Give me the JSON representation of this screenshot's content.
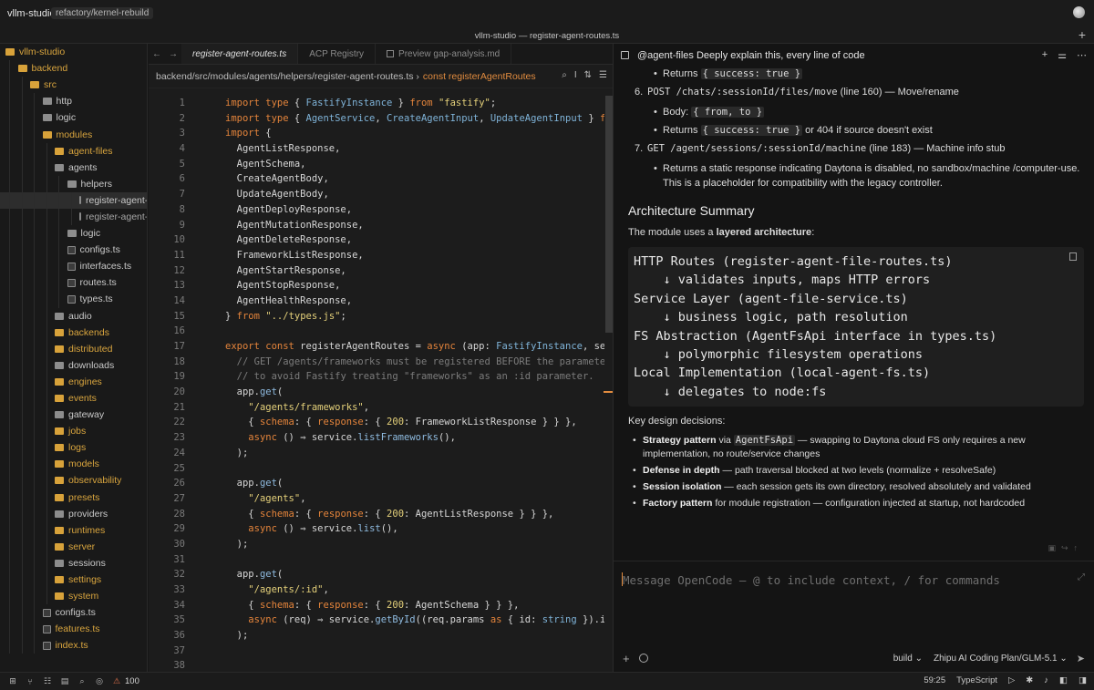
{
  "titlebar": {
    "project": "vllm-studio",
    "branch": "refactory/kernel-rebuild",
    "window_title": "vllm-studio — register-agent-routes.ts",
    "new_tab": "+"
  },
  "sidebar": {
    "items": [
      {
        "label": "vllm-studio",
        "depth": 0,
        "kind": "folder-o",
        "chev": "⌄",
        "color": "orange"
      },
      {
        "label": "backend",
        "depth": 1,
        "kind": "folder-o",
        "chev": "⌄",
        "color": "orange"
      },
      {
        "label": "src",
        "depth": 2,
        "kind": "folder-o",
        "chev": "⌄",
        "color": "orange"
      },
      {
        "label": "http",
        "depth": 3,
        "kind": "folder-g",
        "chev": "",
        "color": "normal"
      },
      {
        "label": "logic",
        "depth": 3,
        "kind": "folder-g",
        "chev": "",
        "color": "normal"
      },
      {
        "label": "modules",
        "depth": 3,
        "kind": "folder-o",
        "chev": "",
        "color": "orange"
      },
      {
        "label": "agent-files",
        "depth": 4,
        "kind": "folder-o",
        "chev": "",
        "color": "orange"
      },
      {
        "label": "agents",
        "depth": 4,
        "kind": "folder-g",
        "chev": "",
        "color": "normal"
      },
      {
        "label": "helpers",
        "depth": 5,
        "kind": "folder-g",
        "chev": "",
        "color": "normal"
      },
      {
        "label": "register-agent-routes.ts",
        "depth": 6,
        "kind": "tsfile",
        "chev": "",
        "color": "normal",
        "active": true
      },
      {
        "label": "register-agent-file-routes.ts",
        "depth": 6,
        "kind": "tsfile",
        "chev": "",
        "color": "gray"
      },
      {
        "label": "logic",
        "depth": 5,
        "kind": "folder-g",
        "chev": "",
        "color": "normal"
      },
      {
        "label": "configs.ts",
        "depth": 5,
        "kind": "tsfile",
        "chev": "",
        "color": "normal"
      },
      {
        "label": "interfaces.ts",
        "depth": 5,
        "kind": "tsfile",
        "chev": "",
        "color": "normal"
      },
      {
        "label": "routes.ts",
        "depth": 5,
        "kind": "tsfile",
        "chev": "",
        "color": "normal"
      },
      {
        "label": "types.ts",
        "depth": 5,
        "kind": "tsfile",
        "chev": "",
        "color": "normal"
      },
      {
        "label": "audio",
        "depth": 4,
        "kind": "folder-g",
        "chev": "",
        "color": "normal"
      },
      {
        "label": "backends",
        "depth": 4,
        "kind": "folder-o",
        "chev": "",
        "color": "orange"
      },
      {
        "label": "distributed",
        "depth": 4,
        "kind": "folder-o",
        "chev": "",
        "color": "orange"
      },
      {
        "label": "downloads",
        "depth": 4,
        "kind": "folder-g",
        "chev": "",
        "color": "normal"
      },
      {
        "label": "engines",
        "depth": 4,
        "kind": "folder-o",
        "chev": "",
        "color": "orange"
      },
      {
        "label": "events",
        "depth": 4,
        "kind": "folder-o",
        "chev": "",
        "color": "orange"
      },
      {
        "label": "gateway",
        "depth": 4,
        "kind": "folder-g",
        "chev": "",
        "color": "normal"
      },
      {
        "label": "jobs",
        "depth": 4,
        "kind": "folder-o",
        "chev": "",
        "color": "orange"
      },
      {
        "label": "logs",
        "depth": 4,
        "kind": "folder-o",
        "chev": "",
        "color": "orange"
      },
      {
        "label": "models",
        "depth": 4,
        "kind": "folder-o",
        "chev": "",
        "color": "orange"
      },
      {
        "label": "observability",
        "depth": 4,
        "kind": "folder-o",
        "chev": "",
        "color": "orange"
      },
      {
        "label": "presets",
        "depth": 4,
        "kind": "folder-o",
        "chev": "",
        "color": "orange"
      },
      {
        "label": "providers",
        "depth": 4,
        "kind": "folder-g",
        "chev": "",
        "color": "normal"
      },
      {
        "label": "runtimes",
        "depth": 4,
        "kind": "folder-o",
        "chev": "",
        "color": "orange"
      },
      {
        "label": "server",
        "depth": 4,
        "kind": "folder-o",
        "chev": "",
        "color": "orange"
      },
      {
        "label": "sessions",
        "depth": 4,
        "kind": "folder-g",
        "chev": "",
        "color": "normal"
      },
      {
        "label": "settings",
        "depth": 4,
        "kind": "folder-o",
        "chev": "",
        "color": "orange"
      },
      {
        "label": "system",
        "depth": 4,
        "kind": "folder-o",
        "chev": "",
        "color": "orange"
      },
      {
        "label": "configs.ts",
        "depth": 3,
        "kind": "tsfile",
        "chev": "",
        "color": "normal"
      },
      {
        "label": "features.ts",
        "depth": 3,
        "kind": "tsfile",
        "chev": "",
        "color": "orange"
      },
      {
        "label": "index.ts",
        "depth": 3,
        "kind": "tsfile",
        "chev": "",
        "color": "orange"
      }
    ]
  },
  "editor": {
    "tabs": [
      {
        "label": "register-agent-routes.ts",
        "active": true
      },
      {
        "label": "ACP Registry",
        "active": false
      },
      {
        "label": "Preview gap-analysis.md",
        "active": false
      }
    ],
    "breadcrumb_path": "backend/src/modules/agents/helpers/register-agent-routes.ts ›",
    "breadcrumb_symbol": "const registerAgentRoutes",
    "lines": [
      {
        "n": "1",
        "h": "<span class='k'>import type</span> { <span class='t'>FastifyInstance</span> } <span class='k'>from</span> <span class='s'>\"fastify\"</span>;"
      },
      {
        "n": "2",
        "h": "<span class='k'>import type</span> { <span class='t'>AgentService</span>, <span class='t'>CreateAgentInput</span>, <span class='t'>UpdateAgentInput</span> } <span class='k'>from</span> <span class='s'>\"./..</span>"
      },
      {
        "n": "3",
        "h": "<span class='k'>import</span> {"
      },
      {
        "n": "4",
        "h": "  AgentListResponse,"
      },
      {
        "n": "5",
        "h": "  AgentSchema,"
      },
      {
        "n": "6",
        "h": "  CreateAgentBody,"
      },
      {
        "n": "7",
        "h": "  UpdateAgentBody,"
      },
      {
        "n": "8",
        "h": "  AgentDeployResponse,"
      },
      {
        "n": "9",
        "h": "  AgentMutationResponse,"
      },
      {
        "n": "10",
        "h": "  AgentDeleteResponse,"
      },
      {
        "n": "11",
        "h": "  FrameworkListResponse,"
      },
      {
        "n": "12",
        "h": "  AgentStartResponse,"
      },
      {
        "n": "13",
        "h": "  AgentStopResponse,"
      },
      {
        "n": "14",
        "h": "  AgentHealthResponse,"
      },
      {
        "n": "15",
        "h": "} <span class='k'>from</span> <span class='s'>\"../types.js\"</span>;"
      },
      {
        "n": "16",
        "h": ""
      },
      {
        "n": "17",
        "h": "<span class='k'>export const</span> registerAgentRoutes = <span class='k'>async</span> (app: <span class='t'>FastifyInstance</span>, service: <span class='t'>Ag</span>"
      },
      {
        "n": "18",
        "h": "  <span class='c'>// GET /agents/frameworks must be registered BEFORE the parameterized</span>"
      },
      {
        "n": "19",
        "h": "  <span class='c'>// to avoid Fastify treating \"frameworks\" as an :id parameter.</span>"
      },
      {
        "n": "20",
        "h": "  app.<span class='f'>get</span>("
      },
      {
        "n": "21",
        "h": "    <span class='s'>\"/agents/frameworks\"</span>,"
      },
      {
        "n": "22",
        "h": "    { <span class='k'>schema</span>: { <span class='k'>response</span>: { <span class='s'>200</span>: FrameworkListResponse } } },"
      },
      {
        "n": "23",
        "h": "    <span class='k'>async</span> () ⇒ service.<span class='f'>listFrameworks</span>(),"
      },
      {
        "n": "24",
        "h": "  );"
      },
      {
        "n": "25",
        "h": ""
      },
      {
        "n": "26",
        "h": "  app.<span class='f'>get</span>("
      },
      {
        "n": "27",
        "h": "    <span class='s'>\"/agents\"</span>,"
      },
      {
        "n": "28",
        "h": "    { <span class='k'>schema</span>: { <span class='k'>response</span>: { <span class='s'>200</span>: AgentListResponse } } },"
      },
      {
        "n": "29",
        "h": "    <span class='k'>async</span> () ⇒ service.<span class='f'>list</span>(),"
      },
      {
        "n": "30",
        "h": "  );"
      },
      {
        "n": "31",
        "h": ""
      },
      {
        "n": "32",
        "h": "  app.<span class='f'>get</span>("
      },
      {
        "n": "33",
        "h": "    <span class='s'>\"/agents/:id\"</span>,"
      },
      {
        "n": "34",
        "h": "    { <span class='k'>schema</span>: { <span class='k'>response</span>: { <span class='s'>200</span>: AgentSchema } } },"
      },
      {
        "n": "35",
        "h": "    <span class='k'>async</span> (req) ⇒ service.<span class='f'>getById</span>((req.params <span class='k'>as</span> { id: <span class='t'>string</span> }).id),"
      },
      {
        "n": "36",
        "h": "  );"
      },
      {
        "n": "37",
        "h": ""
      },
      {
        "n": "38",
        "h": ""
      }
    ]
  },
  "chat": {
    "header_title": "@agent-files  Deeply explain this, every line of code",
    "b1_pre": "Returns ",
    "b1_code": "{ success: true }",
    "n6_num": "6.",
    "n6_route": "POST /chats/:sessionId/files/move",
    "n6_rest": " (line 160) — Move/rename",
    "b2_pre": "Body: ",
    "b2_code": "{ from, to }",
    "b3_pre": "Returns ",
    "b3_code": "{ success: true }",
    "b3_post": " or 404 if source doesn't exist",
    "n7_num": "7.",
    "n7_route": "GET /agent/sessions/:sessionId/machine",
    "n7_rest": " (line 183) — Machine info stub",
    "b4": "Returns a static response indicating Daytona is disabled, no sandbox/machine /computer-use. This is a placeholder for compatibility with the legacy controller.",
    "arch_heading": "Architecture Summary",
    "arch_pre": "The module uses a ",
    "arch_bold": "layered architecture",
    "arch_post": ":",
    "code_block": "HTTP Routes (register-agent-file-routes.ts)\n    ↓ validates inputs, maps HTTP errors\nService Layer (agent-file-service.ts)\n    ↓ business logic, path resolution\nFS Abstraction (AgentFsApi interface in types.ts)\n    ↓ polymorphic filesystem operations\nLocal Implementation (local-agent-fs.ts)\n    ↓ delegates to node:fs",
    "key_decisions": "Key design decisions:",
    "d1_bold": "Strategy pattern",
    "d1_pre": " via ",
    "d1_code": "AgentFsApi",
    "d1_rest": " — swapping to Daytona cloud FS only requires a new implementation, no route/service changes",
    "d2_bold": "Defense in depth",
    "d2_rest": " — path traversal blocked at two levels (normalize + resolveSafe)",
    "d3_bold": "Session isolation",
    "d3_rest": " — each session gets its own directory, resolved absolutely and validated",
    "d4_bold": "Factory pattern",
    "d4_rest": " for module registration — configuration injected at startup, not hardcoded",
    "composer_placeholder": "Message OpenCode — @ to include context, / for commands",
    "mode": "build ⌄",
    "model": "Zhipu AI Coding Plan/GLM-5.1 ⌄"
  },
  "status": {
    "warnings": "100",
    "cursor": "59:25",
    "language": "TypeScript"
  }
}
